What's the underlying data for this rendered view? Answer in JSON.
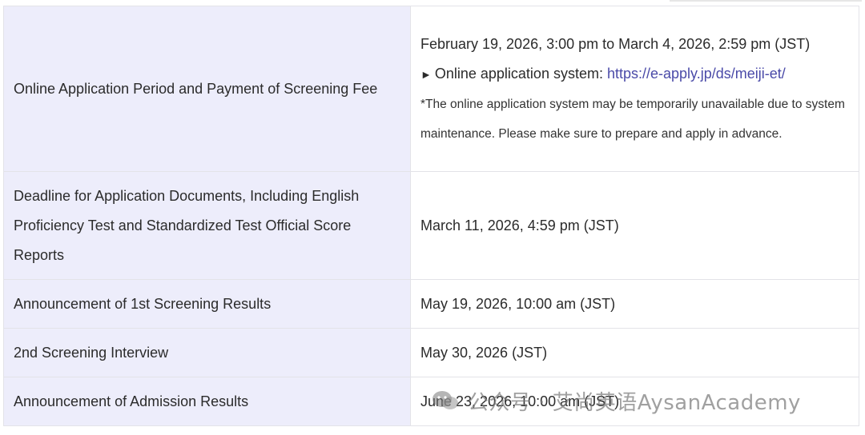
{
  "rows": [
    {
      "label": "Online Application Period and Payment of Screening Fee",
      "value_line1": "February 19, 2026, 3:00 pm to March 4, 2026, 2:59 pm (JST)",
      "value_prefix": "Online application system: ",
      "value_link": "https://e-apply.jp/ds/meiji-et/",
      "value_note": "*The online application system may be temporarily unavailable due to system maintenance. Please make sure to prepare and apply in advance."
    },
    {
      "label": "Deadline for Application Documents, Including English Proficiency Test and Standardized Test Official Score Reports",
      "value": "March 11, 2026, 4:59 pm (JST)"
    },
    {
      "label": "Announcement of 1st Screening Results",
      "value": "May 19, 2026, 10:00 am (JST)"
    },
    {
      "label": "2nd Screening Interview",
      "value": "May 30, 2026 (JST)"
    },
    {
      "label": "Announcement of Admission Results",
      "value": "June 23, 2026, 10:00 am (JST)"
    }
  ],
  "watermark": {
    "text": "公众号 · 艾尚英语AysanAcademy",
    "icon": "wechat-icon"
  },
  "colors": {
    "label_bg": "#ededfb",
    "link": "#4a4aa8",
    "border": "#e3e3e8"
  }
}
